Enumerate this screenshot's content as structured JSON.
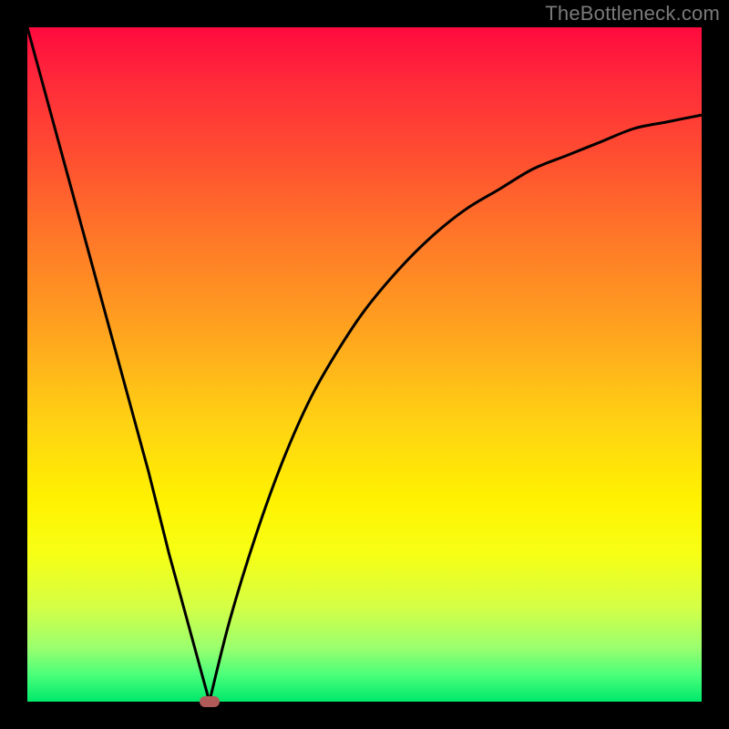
{
  "watermark": "TheBottleneck.com",
  "colors": {
    "frame": "#000000",
    "marker": "#b05a5a",
    "curve": "#000000"
  },
  "chart_data": {
    "type": "line",
    "title": "",
    "xlabel": "",
    "ylabel": "",
    "xlim": [
      0,
      100
    ],
    "ylim": [
      0,
      100
    ],
    "grid": false,
    "legend": false,
    "minimum_x": 27,
    "marker": {
      "x": 27,
      "y": 0
    },
    "series": [
      {
        "name": "left-branch",
        "x": [
          0,
          3,
          6,
          9,
          12,
          15,
          18,
          21,
          24,
          27
        ],
        "y": [
          100,
          89,
          78,
          67,
          56,
          45,
          34,
          22,
          11,
          0
        ]
      },
      {
        "name": "right-branch",
        "x": [
          27,
          30,
          34,
          38,
          42,
          46,
          50,
          55,
          60,
          65,
          70,
          75,
          80,
          85,
          90,
          95,
          100
        ],
        "y": [
          0,
          12,
          25,
          36,
          45,
          52,
          58,
          64,
          69,
          73,
          76,
          79,
          81,
          83,
          85,
          86,
          87
        ]
      }
    ]
  }
}
